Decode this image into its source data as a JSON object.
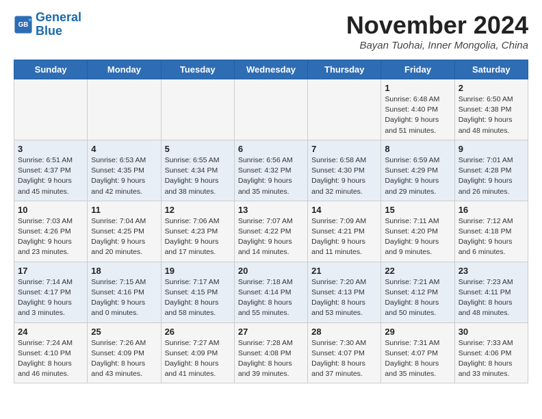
{
  "logo": {
    "line1": "General",
    "line2": "Blue"
  },
  "title": "November 2024",
  "location": "Bayan Tuohai, Inner Mongolia, China",
  "days_of_week": [
    "Sunday",
    "Monday",
    "Tuesday",
    "Wednesday",
    "Thursday",
    "Friday",
    "Saturday"
  ],
  "weeks": [
    [
      {
        "day": "",
        "info": ""
      },
      {
        "day": "",
        "info": ""
      },
      {
        "day": "",
        "info": ""
      },
      {
        "day": "",
        "info": ""
      },
      {
        "day": "",
        "info": ""
      },
      {
        "day": "1",
        "info": "Sunrise: 6:48 AM\nSunset: 4:40 PM\nDaylight: 9 hours\nand 51 minutes."
      },
      {
        "day": "2",
        "info": "Sunrise: 6:50 AM\nSunset: 4:38 PM\nDaylight: 9 hours\nand 48 minutes."
      }
    ],
    [
      {
        "day": "3",
        "info": "Sunrise: 6:51 AM\nSunset: 4:37 PM\nDaylight: 9 hours\nand 45 minutes."
      },
      {
        "day": "4",
        "info": "Sunrise: 6:53 AM\nSunset: 4:35 PM\nDaylight: 9 hours\nand 42 minutes."
      },
      {
        "day": "5",
        "info": "Sunrise: 6:55 AM\nSunset: 4:34 PM\nDaylight: 9 hours\nand 38 minutes."
      },
      {
        "day": "6",
        "info": "Sunrise: 6:56 AM\nSunset: 4:32 PM\nDaylight: 9 hours\nand 35 minutes."
      },
      {
        "day": "7",
        "info": "Sunrise: 6:58 AM\nSunset: 4:30 PM\nDaylight: 9 hours\nand 32 minutes."
      },
      {
        "day": "8",
        "info": "Sunrise: 6:59 AM\nSunset: 4:29 PM\nDaylight: 9 hours\nand 29 minutes."
      },
      {
        "day": "9",
        "info": "Sunrise: 7:01 AM\nSunset: 4:28 PM\nDaylight: 9 hours\nand 26 minutes."
      }
    ],
    [
      {
        "day": "10",
        "info": "Sunrise: 7:03 AM\nSunset: 4:26 PM\nDaylight: 9 hours\nand 23 minutes."
      },
      {
        "day": "11",
        "info": "Sunrise: 7:04 AM\nSunset: 4:25 PM\nDaylight: 9 hours\nand 20 minutes."
      },
      {
        "day": "12",
        "info": "Sunrise: 7:06 AM\nSunset: 4:23 PM\nDaylight: 9 hours\nand 17 minutes."
      },
      {
        "day": "13",
        "info": "Sunrise: 7:07 AM\nSunset: 4:22 PM\nDaylight: 9 hours\nand 14 minutes."
      },
      {
        "day": "14",
        "info": "Sunrise: 7:09 AM\nSunset: 4:21 PM\nDaylight: 9 hours\nand 11 minutes."
      },
      {
        "day": "15",
        "info": "Sunrise: 7:11 AM\nSunset: 4:20 PM\nDaylight: 9 hours\nand 9 minutes."
      },
      {
        "day": "16",
        "info": "Sunrise: 7:12 AM\nSunset: 4:18 PM\nDaylight: 9 hours\nand 6 minutes."
      }
    ],
    [
      {
        "day": "17",
        "info": "Sunrise: 7:14 AM\nSunset: 4:17 PM\nDaylight: 9 hours\nand 3 minutes."
      },
      {
        "day": "18",
        "info": "Sunrise: 7:15 AM\nSunset: 4:16 PM\nDaylight: 9 hours\nand 0 minutes."
      },
      {
        "day": "19",
        "info": "Sunrise: 7:17 AM\nSunset: 4:15 PM\nDaylight: 8 hours\nand 58 minutes."
      },
      {
        "day": "20",
        "info": "Sunrise: 7:18 AM\nSunset: 4:14 PM\nDaylight: 8 hours\nand 55 minutes."
      },
      {
        "day": "21",
        "info": "Sunrise: 7:20 AM\nSunset: 4:13 PM\nDaylight: 8 hours\nand 53 minutes."
      },
      {
        "day": "22",
        "info": "Sunrise: 7:21 AM\nSunset: 4:12 PM\nDaylight: 8 hours\nand 50 minutes."
      },
      {
        "day": "23",
        "info": "Sunrise: 7:23 AM\nSunset: 4:11 PM\nDaylight: 8 hours\nand 48 minutes."
      }
    ],
    [
      {
        "day": "24",
        "info": "Sunrise: 7:24 AM\nSunset: 4:10 PM\nDaylight: 8 hours\nand 46 minutes."
      },
      {
        "day": "25",
        "info": "Sunrise: 7:26 AM\nSunset: 4:09 PM\nDaylight: 8 hours\nand 43 minutes."
      },
      {
        "day": "26",
        "info": "Sunrise: 7:27 AM\nSunset: 4:09 PM\nDaylight: 8 hours\nand 41 minutes."
      },
      {
        "day": "27",
        "info": "Sunrise: 7:28 AM\nSunset: 4:08 PM\nDaylight: 8 hours\nand 39 minutes."
      },
      {
        "day": "28",
        "info": "Sunrise: 7:30 AM\nSunset: 4:07 PM\nDaylight: 8 hours\nand 37 minutes."
      },
      {
        "day": "29",
        "info": "Sunrise: 7:31 AM\nSunset: 4:07 PM\nDaylight: 8 hours\nand 35 minutes."
      },
      {
        "day": "30",
        "info": "Sunrise: 7:33 AM\nSunset: 4:06 PM\nDaylight: 8 hours\nand 33 minutes."
      }
    ]
  ]
}
